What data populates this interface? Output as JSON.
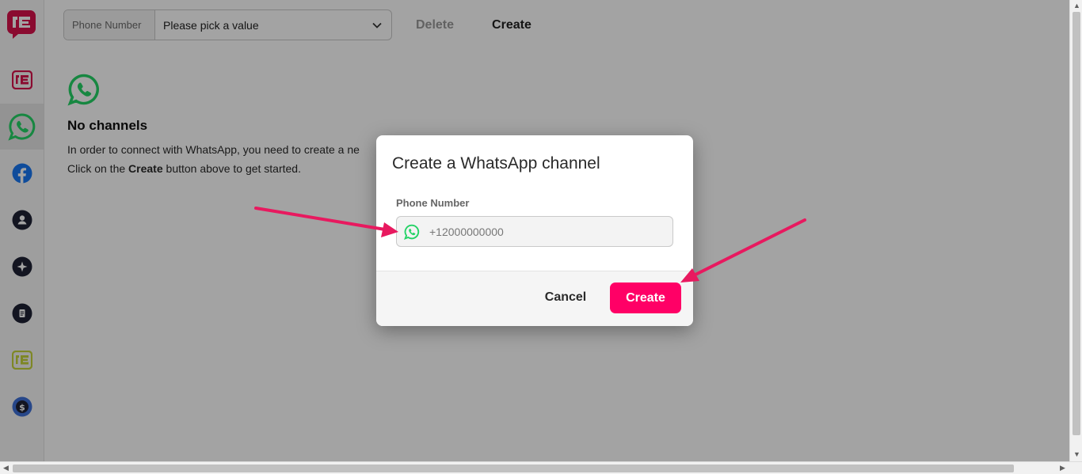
{
  "colors": {
    "brand": "#d8124b",
    "accent": "#ff0066",
    "whatsapp": "#25d366",
    "facebook": "#1877f2",
    "annotation_arrow": "#e8195f"
  },
  "sidebar": {
    "logo_icon": "brand-logo-icon",
    "items": [
      {
        "icon": "brand-logo-icon",
        "active": false
      },
      {
        "icon": "whatsapp-icon",
        "active": true
      },
      {
        "icon": "facebook-icon",
        "active": false
      },
      {
        "icon": "user-icon",
        "active": false
      },
      {
        "icon": "sparkle-icon",
        "active": false
      },
      {
        "icon": "document-icon",
        "active": false
      },
      {
        "icon": "brand-logo-lime-icon",
        "active": false
      },
      {
        "icon": "dollar-icon",
        "active": false
      }
    ]
  },
  "toolbar": {
    "phone_label": "Phone Number",
    "phone_select_value": "Please pick a value",
    "delete_label": "Delete",
    "create_label": "Create"
  },
  "empty_state": {
    "icon": "whatsapp-icon",
    "title": "No channels",
    "line1": "In order to connect with WhatsApp, you need to create a ne",
    "line2_prefix": "Click on the ",
    "line2_bold": "Create",
    "line2_suffix": " button above to get started."
  },
  "modal": {
    "title": "Create a WhatsApp channel",
    "field_label": "Phone Number",
    "field_placeholder": "+12000000000",
    "field_value": "",
    "cancel_label": "Cancel",
    "create_label": "Create"
  }
}
